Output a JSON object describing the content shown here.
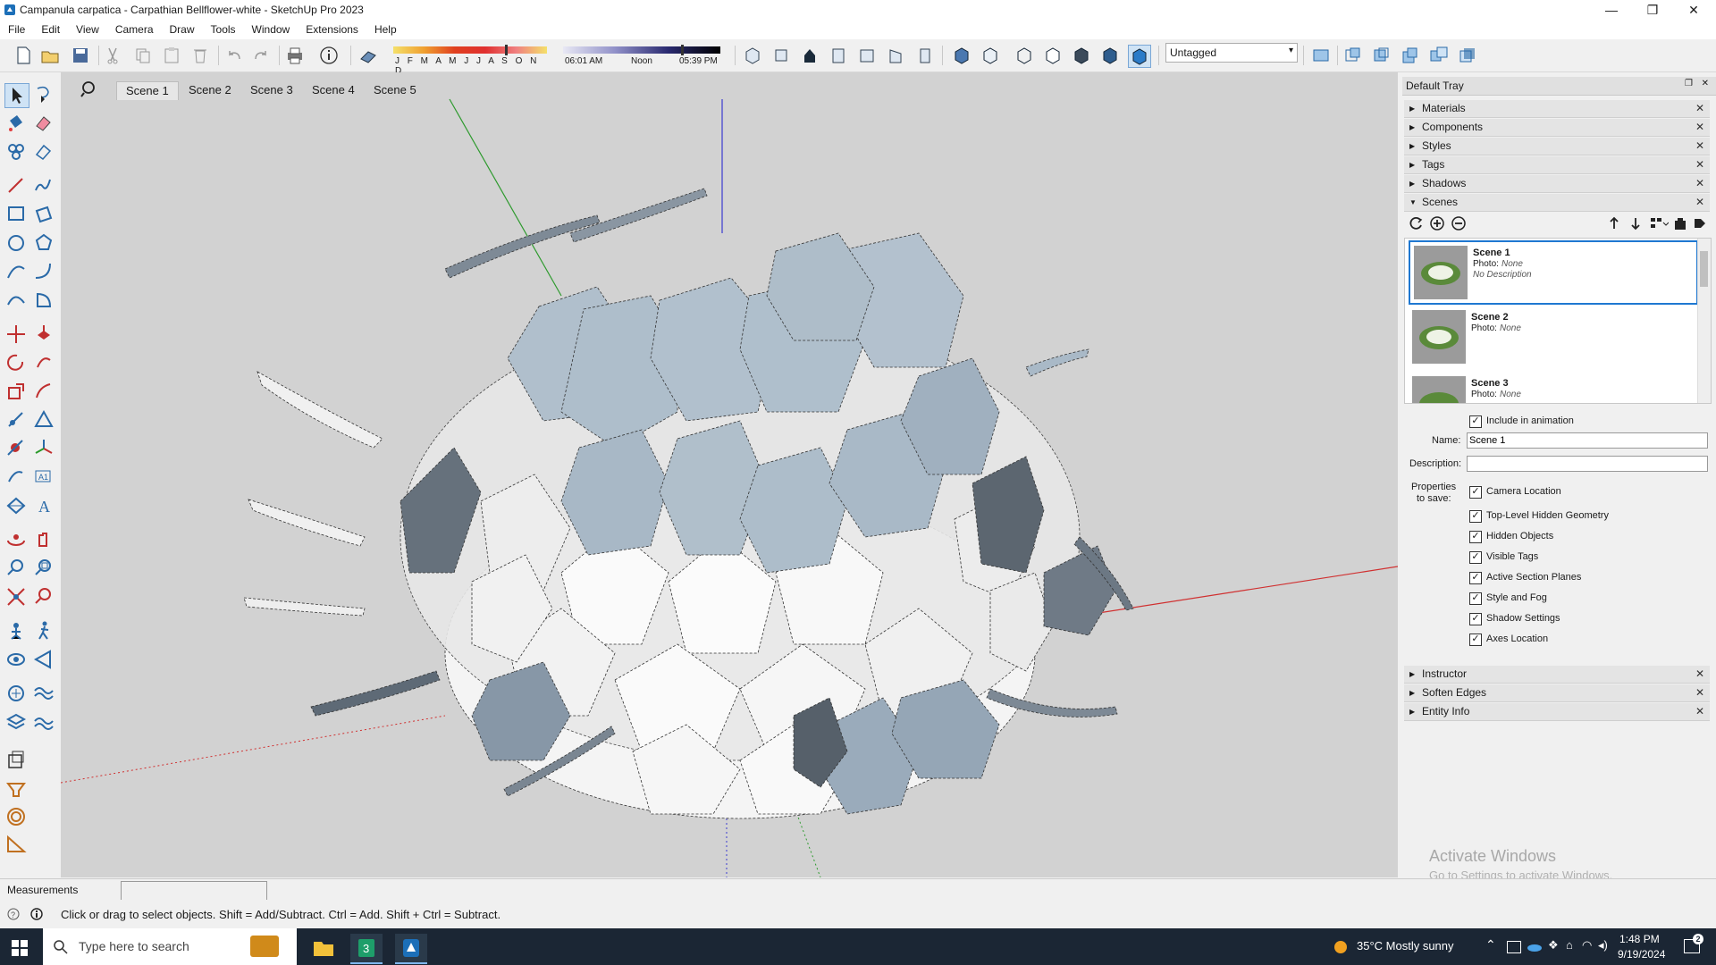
{
  "window": {
    "title": "Campanula carpatica - Carpathian Bellflower-white - SketchUp Pro 2023",
    "minimize": "—",
    "restore": "❐",
    "close": "✕"
  },
  "menu": [
    "File",
    "Edit",
    "View",
    "Camera",
    "Draw",
    "Tools",
    "Window",
    "Extensions",
    "Help"
  ],
  "toolbar": {
    "months": "J F M A M J J A S O N D",
    "time_start": "06:01 AM",
    "time_noon": "Noon",
    "time_end": "05:39 PM",
    "tag_select": "Untagged"
  },
  "viewport": {
    "scene_tabs": [
      "Scene 1",
      "Scene 2",
      "Scene 3",
      "Scene 4",
      "Scene 5"
    ],
    "active_tab": "Scene 1"
  },
  "tray": {
    "title": "Default Tray",
    "panels_top": [
      "Materials",
      "Components",
      "Styles",
      "Tags",
      "Shadows"
    ],
    "scenes_panel": "Scenes",
    "scenes": [
      {
        "name": "Scene 1",
        "photo_label": "Photo:",
        "photo": "None",
        "description": "No Description"
      },
      {
        "name": "Scene 2",
        "photo_label": "Photo:",
        "photo": "None",
        "description": ""
      },
      {
        "name": "Scene 3",
        "photo_label": "Photo:",
        "photo": "None",
        "description": ""
      }
    ],
    "include_in_animation": "Include in animation",
    "name_label": "Name:",
    "name_value": "Scene 1",
    "description_label": "Description:",
    "description_value": "",
    "properties_label_1": "Properties",
    "properties_label_2": "to save:",
    "properties": [
      "Camera Location",
      "Top-Level Hidden Geometry",
      "Hidden Objects",
      "Visible Tags",
      "Active Section Planes",
      "Style and Fog",
      "Shadow Settings",
      "Axes Location"
    ],
    "panels_bottom": [
      "Instructor",
      "Soften Edges",
      "Entity Info"
    ],
    "watermark_title": "Activate Windows",
    "watermark_sub": "Go to Settings to activate Windows."
  },
  "measurements": {
    "label": "Measurements",
    "value": ""
  },
  "status": {
    "text": "Click or drag to select objects. Shift = Add/Subtract. Ctrl = Add. Shift + Ctrl = Subtract."
  },
  "taskbar": {
    "search_placeholder": "Type here to search",
    "weather": "35°C  Mostly sunny",
    "time": "1:48 PM",
    "date": "9/19/2024"
  },
  "colors": {
    "viewport_bg": "#d2d2d2",
    "selection_blue": "#1f78d1",
    "taskbar": "#1b2634"
  }
}
